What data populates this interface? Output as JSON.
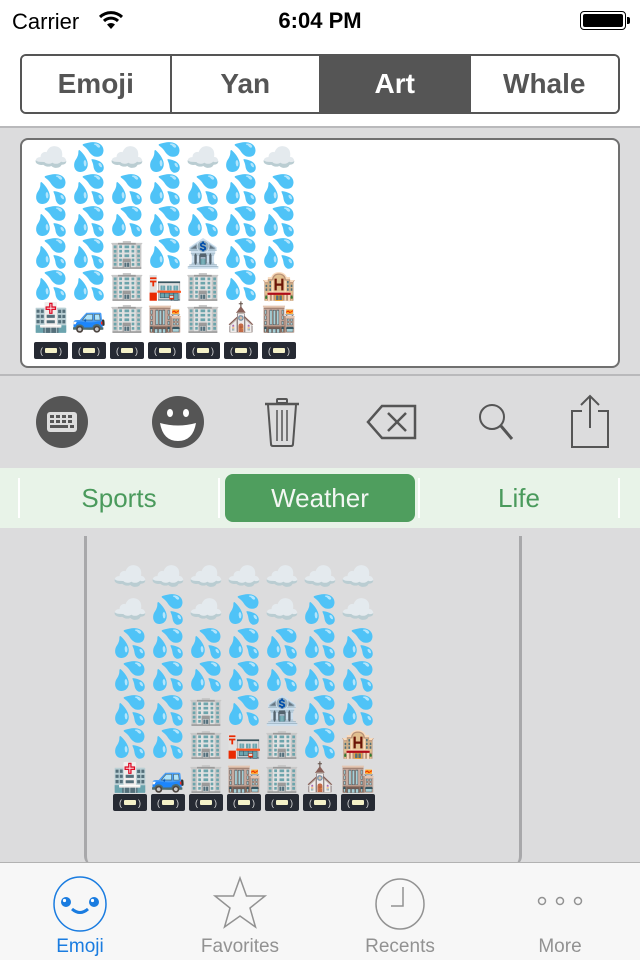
{
  "status_bar": {
    "carrier": "Carrier",
    "time": "6:04 PM",
    "battery_level": 1.0
  },
  "segments": {
    "items": [
      {
        "label": "Emoji",
        "active": false
      },
      {
        "label": "Yan",
        "active": false
      },
      {
        "label": "Art",
        "active": true
      },
      {
        "label": "Whale",
        "active": false
      }
    ]
  },
  "preview": {
    "rows": [
      [
        "☁️",
        "💦",
        "☁️",
        "💦",
        "☁️",
        "💦",
        "☁️"
      ],
      [
        "💦",
        "💦",
        "💦",
        "💦",
        "💦",
        "💦",
        "💦"
      ],
      [
        "💦",
        "💦",
        "💦",
        "💦",
        "💦",
        "💦",
        "💦"
      ],
      [
        "💦",
        "💦",
        "🏢",
        "💦",
        "🏦",
        "💦",
        "💦"
      ],
      [
        "💦",
        "💦",
        "🏢",
        "🏣",
        "🏢",
        "💦",
        "🏨"
      ],
      [
        "🏥",
        "🚙",
        "🏢",
        "🏬",
        "🏢",
        "⛪",
        "🏬"
      ]
    ],
    "footer": [
      "📼",
      "📼",
      "📼",
      "📼",
      "📼",
      "📼",
      "📼"
    ]
  },
  "toolbar": {
    "items": [
      {
        "name": "keyboard-icon"
      },
      {
        "name": "smiley-icon"
      },
      {
        "name": "trash-icon"
      },
      {
        "name": "backspace-icon"
      },
      {
        "name": "search-icon"
      },
      {
        "name": "share-icon"
      }
    ]
  },
  "categories": {
    "items": [
      {
        "label": "Sports",
        "active": false
      },
      {
        "label": "Weather",
        "active": true
      },
      {
        "label": "Life",
        "active": false
      }
    ]
  },
  "board": {
    "rows": [
      [
        "☁️",
        "☁️",
        "☁️",
        "☁️",
        "☁️",
        "☁️",
        "☁️"
      ],
      [
        "☁️",
        "💦",
        "☁️",
        "💦",
        "☁️",
        "💦",
        "☁️"
      ],
      [
        "💦",
        "💦",
        "💦",
        "💦",
        "💦",
        "💦",
        "💦"
      ],
      [
        "💦",
        "💦",
        "💦",
        "💦",
        "💦",
        "💦",
        "💦"
      ],
      [
        "💦",
        "💦",
        "🏢",
        "💦",
        "🏦",
        "💦",
        "💦"
      ],
      [
        "💦",
        "💦",
        "🏢",
        "🏣",
        "🏢",
        "💦",
        "🏨"
      ],
      [
        "🏥",
        "🚙",
        "🏢",
        "🏬",
        "🏢",
        "⛪",
        "🏬"
      ]
    ],
    "footer": [
      "📼",
      "📼",
      "📼",
      "📼",
      "📼",
      "📼",
      "📼"
    ]
  },
  "tabbar": {
    "items": [
      {
        "label": "Emoji",
        "icon": "emoji-face-icon",
        "active": true
      },
      {
        "label": "Favorites",
        "icon": "star-icon",
        "active": false
      },
      {
        "label": "Recents",
        "icon": "clock-icon",
        "active": false
      },
      {
        "label": "More",
        "icon": "more-dots-icon",
        "active": false
      }
    ]
  },
  "colors": {
    "segment_active": "#555555",
    "category_active": "#4f9e5e",
    "category_text": "#4a9a5c",
    "tab_active": "#1a7ce0",
    "tab_inactive": "#929292"
  }
}
